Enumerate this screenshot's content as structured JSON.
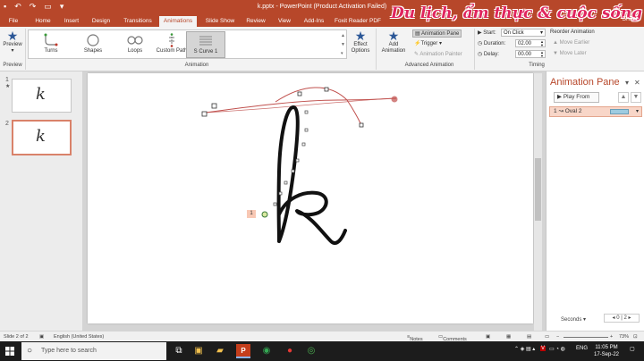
{
  "window": {
    "title": "k.pptx - PowerPoint (Product Activation Failed)"
  },
  "watermark": "Du lịch, ẩm thực & cuộc sống",
  "share_label": "Share",
  "tabs": [
    "File",
    "Home",
    "Insert",
    "Design",
    "Transitions",
    "Animations",
    "Slide Show",
    "Review",
    "View",
    "Add-Ins",
    "Foxit Reader PDF"
  ],
  "active_tab": "Animations",
  "ribbon": {
    "preview": {
      "label": "Preview",
      "group": "Preview"
    },
    "gallery": {
      "items": [
        {
          "label": "Turns",
          "icon": "turns-icon"
        },
        {
          "label": "Shapes",
          "icon": "shapes-icon"
        },
        {
          "label": "Loops",
          "icon": "loops-icon"
        },
        {
          "label": "Custom Path",
          "icon": "custom-path-icon"
        },
        {
          "label": "S Curve 1",
          "icon": "s-curve-icon",
          "selected": true
        }
      ],
      "group": "Animation"
    },
    "effect_options": {
      "line1": "Effect",
      "line2": "Options"
    },
    "add_animation": {
      "line1": "Add",
      "line2": "Animation"
    },
    "animation_pane_btn": "Animation Pane",
    "trigger": "Trigger",
    "animation_painter": "Animation Painter",
    "advanced_group": "Advanced Animation",
    "start_label": "Start:",
    "start_value": "On Click",
    "duration_label": "Duration:",
    "duration_value": "02.00",
    "delay_label": "Delay:",
    "delay_value": "00.00",
    "reorder_label": "Reorder Animation",
    "move_earlier": "Move Earlier",
    "move_later": "Move Later",
    "timing_group": "Timing"
  },
  "thumbnails": [
    {
      "num": "1",
      "star": "★",
      "glyph": "k"
    },
    {
      "num": "2",
      "star": "",
      "glyph": "k"
    }
  ],
  "slide": {
    "letter": "k",
    "anim_tag": "1"
  },
  "animation_pane": {
    "title": "Animation Pane",
    "play_from": "Play From",
    "item_number": "1",
    "item_label": "Oval 2",
    "seconds_label": "Seconds",
    "seconds_value": "0",
    "seconds_end": "2"
  },
  "status_bar": {
    "slide": "Slide 2 of 2",
    "language": "English (United States)",
    "notes": "Notes",
    "comments": "Comments",
    "zoom": "73%"
  },
  "taskbar": {
    "search_placeholder": "Type here to search",
    "lang": "ENG",
    "time": "11:05 PM",
    "date": "17-Sep-22"
  }
}
